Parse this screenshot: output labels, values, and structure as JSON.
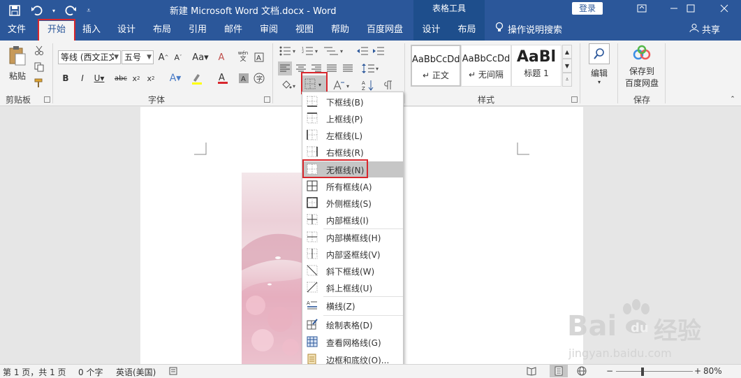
{
  "titlebar": {
    "doc_title": "新建 Microsoft Word 文档.docx  -  Word",
    "context_tools": "表格工具",
    "login": "登录"
  },
  "tabs": {
    "file": "文件",
    "home": "开始",
    "insert": "插入",
    "design": "设计",
    "layout": "布局",
    "references": "引用",
    "mailings": "邮件",
    "review": "审阅",
    "view": "视图",
    "help": "帮助",
    "baidu": "百度网盘",
    "table_design": "设计",
    "table_layout": "布局",
    "tell_me": "操作说明搜索",
    "share": "共享"
  },
  "ribbon": {
    "paste": "粘贴",
    "clipboard_label": "剪贴板",
    "font_name": "等线 (西文正文",
    "font_size": "五号",
    "font_label": "字体",
    "styles_label": "样式",
    "styles": [
      {
        "sample": "AaBbCcDd",
        "name": "正文"
      },
      {
        "sample": "AaBbCcDd",
        "name": "无间隔"
      },
      {
        "sample": "AaBl",
        "name": "标题 1"
      }
    ],
    "edit": "编辑",
    "save_baidu_line1": "保存到",
    "save_baidu_line2": "百度网盘",
    "save_label": "保存"
  },
  "menu": {
    "items": [
      "下框线(B)",
      "上框线(P)",
      "左框线(L)",
      "右框线(R)",
      "无框线(N)",
      "所有框线(A)",
      "外侧框线(S)",
      "内部框线(I)",
      "内部横框线(H)",
      "内部竖框线(V)",
      "斜下框线(W)",
      "斜上框线(U)",
      "横线(Z)",
      "绘制表格(D)",
      "查看网格线(G)",
      "边框和底纹(O)..."
    ]
  },
  "status": {
    "page": "第 1 页，共 1 页",
    "words": "0 个字",
    "language": "英语(美国)",
    "zoom": "80%"
  },
  "watermark": {
    "brand": "Bai",
    "brand2": "经验",
    "url": "jingyan.baidu.com"
  },
  "colors": {
    "title_blue": "#2b579a",
    "highlight_red": "#d8272d"
  }
}
